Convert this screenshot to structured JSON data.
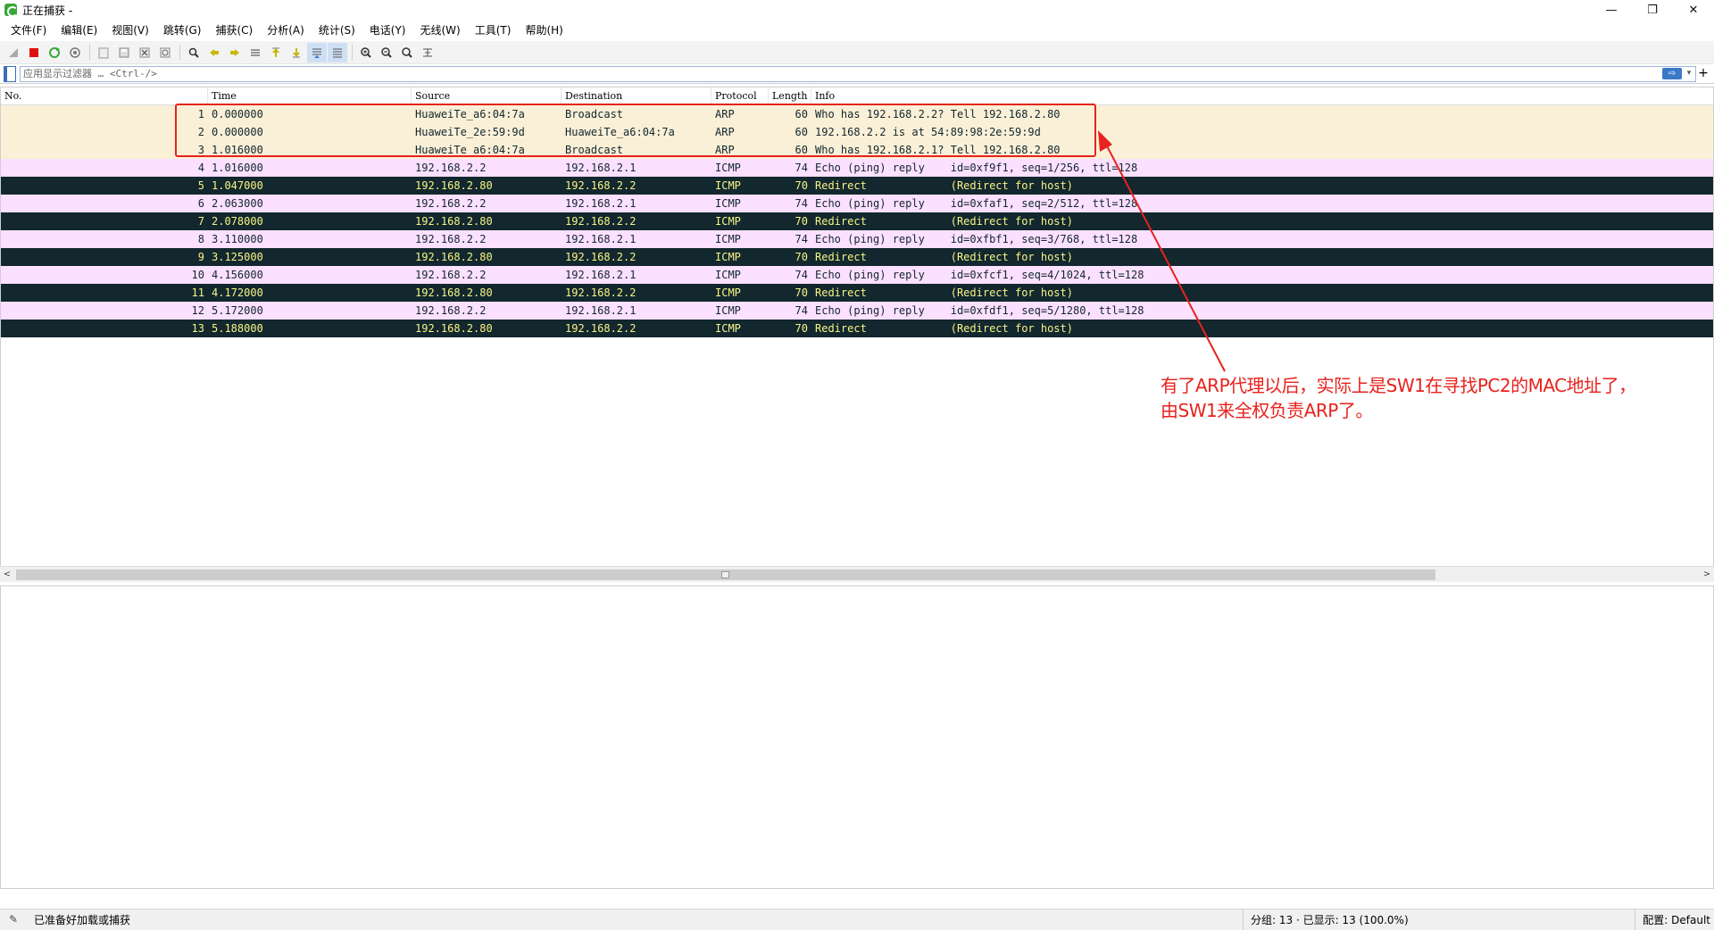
{
  "window": {
    "title": "正在捕获 -",
    "minimize": "—",
    "restore": "❐",
    "close": "✕"
  },
  "menu": [
    "文件(F)",
    "编辑(E)",
    "视图(V)",
    "跳转(G)",
    "捕获(C)",
    "分析(A)",
    "统计(S)",
    "电话(Y)",
    "无线(W)",
    "工具(T)",
    "帮助(H)"
  ],
  "filter": {
    "placeholder": "应用显示过滤器 … <Ctrl-/>",
    "apply": "⇨",
    "dropdown": "▾",
    "add": "+"
  },
  "columns": {
    "no": "No.",
    "time": "Time",
    "source": "Source",
    "destination": "Destination",
    "protocol": "Protocol",
    "length": "Length",
    "info": "Info"
  },
  "packets": [
    {
      "no": "1",
      "time": "0.000000",
      "source": "HuaweiTe_a6:04:7a",
      "destination": "Broadcast",
      "protocol": "ARP",
      "length": "60",
      "info": "Who has 192.168.2.2? Tell 192.168.2.80",
      "kind": "arp"
    },
    {
      "no": "2",
      "time": "0.000000",
      "source": "HuaweiTe_2e:59:9d",
      "destination": "HuaweiTe_a6:04:7a",
      "protocol": "ARP",
      "length": "60",
      "info": "192.168.2.2 is at 54:89:98:2e:59:9d",
      "kind": "arp"
    },
    {
      "no": "3",
      "time": "1.016000",
      "source": "HuaweiTe_a6:04:7a",
      "destination": "Broadcast",
      "protocol": "ARP",
      "length": "60",
      "info": "Who has 192.168.2.1? Tell 192.168.2.80",
      "kind": "arp"
    },
    {
      "no": "4",
      "time": "1.016000",
      "source": "192.168.2.2",
      "destination": "192.168.2.1",
      "protocol": "ICMP",
      "length": "74",
      "info": "Echo (ping) reply    id=0xf9f1, seq=1/256, ttl=128",
      "kind": "icmp"
    },
    {
      "no": "5",
      "time": "1.047000",
      "source": "192.168.2.80",
      "destination": "192.168.2.2",
      "protocol": "ICMP",
      "length": "70",
      "info": "Redirect             (Redirect for host)",
      "kind": "bad"
    },
    {
      "no": "6",
      "time": "2.063000",
      "source": "192.168.2.2",
      "destination": "192.168.2.1",
      "protocol": "ICMP",
      "length": "74",
      "info": "Echo (ping) reply    id=0xfaf1, seq=2/512, ttl=128",
      "kind": "icmp"
    },
    {
      "no": "7",
      "time": "2.078000",
      "source": "192.168.2.80",
      "destination": "192.168.2.2",
      "protocol": "ICMP",
      "length": "70",
      "info": "Redirect             (Redirect for host)",
      "kind": "bad"
    },
    {
      "no": "8",
      "time": "3.110000",
      "source": "192.168.2.2",
      "destination": "192.168.2.1",
      "protocol": "ICMP",
      "length": "74",
      "info": "Echo (ping) reply    id=0xfbf1, seq=3/768, ttl=128",
      "kind": "icmp"
    },
    {
      "no": "9",
      "time": "3.125000",
      "source": "192.168.2.80",
      "destination": "192.168.2.2",
      "protocol": "ICMP",
      "length": "70",
      "info": "Redirect             (Redirect for host)",
      "kind": "bad"
    },
    {
      "no": "10",
      "time": "4.156000",
      "source": "192.168.2.2",
      "destination": "192.168.2.1",
      "protocol": "ICMP",
      "length": "74",
      "info": "Echo (ping) reply    id=0xfcf1, seq=4/1024, ttl=128",
      "kind": "icmp"
    },
    {
      "no": "11",
      "time": "4.172000",
      "source": "192.168.2.80",
      "destination": "192.168.2.2",
      "protocol": "ICMP",
      "length": "70",
      "info": "Redirect             (Redirect for host)",
      "kind": "bad"
    },
    {
      "no": "12",
      "time": "5.172000",
      "source": "192.168.2.2",
      "destination": "192.168.2.1",
      "protocol": "ICMP",
      "length": "74",
      "info": "Echo (ping) reply    id=0xfdf1, seq=5/1280, ttl=128",
      "kind": "icmp"
    },
    {
      "no": "13",
      "time": "5.188000",
      "source": "192.168.2.80",
      "destination": "192.168.2.2",
      "protocol": "ICMP",
      "length": "70",
      "info": "Redirect             (Redirect for host)",
      "kind": "bad"
    }
  ],
  "annotation": {
    "line1": "有了ARP代理以后，实际上是SW1在寻找PC2的MAC地址了，",
    "line2": "由SW1来全权负责ARP了。",
    "color": "#e8221d"
  },
  "status": {
    "ready": "已准备好加载或捕获",
    "counts": "分组: 13 · 已显示: 13 (100.0%)",
    "profile": "配置: Default"
  },
  "colors": {
    "arp_row": "#faf0d7",
    "icmp_row": "#fce0ff",
    "bad_row_bg": "#12272e",
    "bad_row_fg": "#f7f585"
  }
}
